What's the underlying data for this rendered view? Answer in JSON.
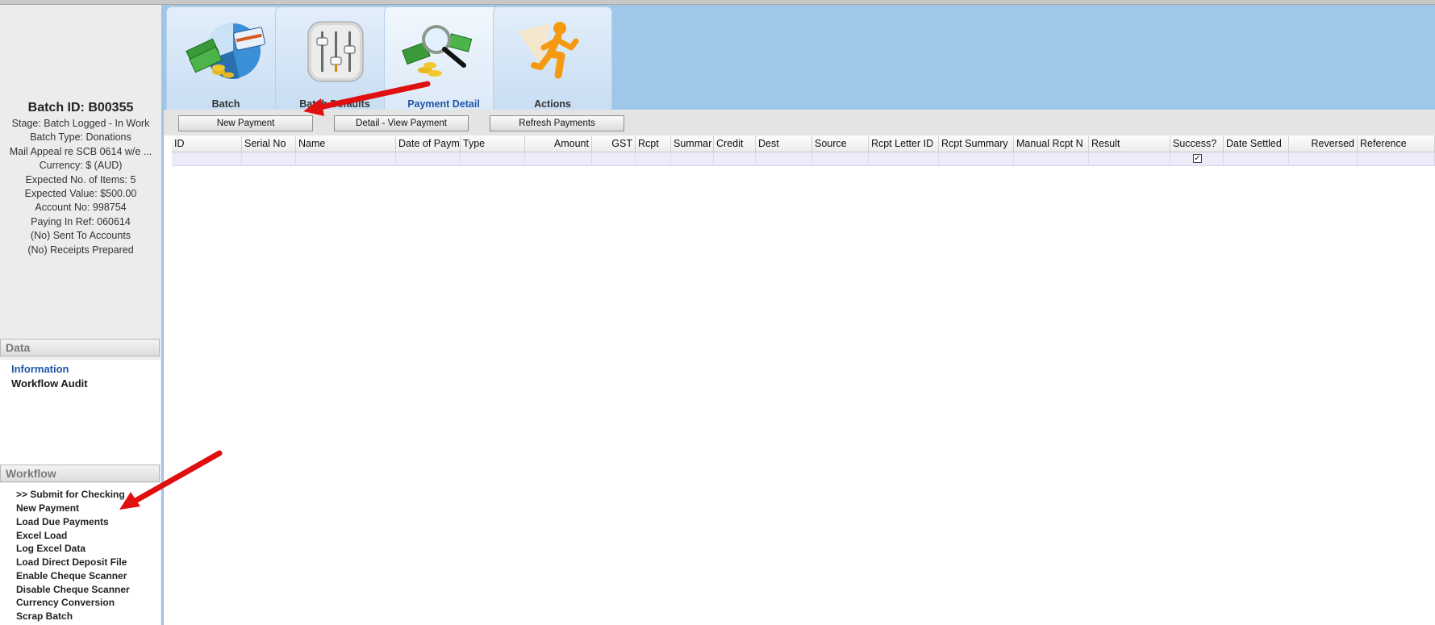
{
  "left_panel": {
    "batch_id": "Batch ID: B00355",
    "info_lines": [
      "Stage: Batch Logged - In Work",
      "Batch Type: Donations",
      "Mail Appeal re SCB 0614 w/e ...",
      "Currency: $ (AUD)",
      "Expected No. of Items: 5",
      "Expected Value: $500.00",
      "Account No: 998754",
      "Paying In Ref: 060614",
      "(No) Sent To Accounts",
      "(No) Receipts Prepared"
    ],
    "data_section": {
      "title": "Data",
      "links": [
        "Information",
        "Workflow Audit"
      ]
    },
    "workflow_section": {
      "title": "Workflow",
      "items": [
        ">> Submit for Checking",
        "New Payment",
        "Load Due Payments",
        "Excel Load",
        "Log Excel Data",
        "Load Direct Deposit File",
        "Enable Cheque Scanner",
        "Disable Cheque Scanner",
        "Currency Conversion",
        "Scrap Batch"
      ]
    }
  },
  "tabs": [
    {
      "label": "Batch",
      "icon": "pie-chart-money-icon"
    },
    {
      "label": "Batch Defaults",
      "icon": "sliders-icon"
    },
    {
      "label": "Payment Detail",
      "icon": "magnifier-money-icon"
    },
    {
      "label": "Actions",
      "icon": "running-man-icon"
    }
  ],
  "active_tab": "Payment Detail",
  "toolbar": {
    "new_payment": "New Payment",
    "detail_view": "Detail - View Payment",
    "refresh": "Refresh Payments"
  },
  "grid": {
    "columns": [
      "ID",
      "Serial No",
      "Name",
      "Date of Paym",
      "Type",
      "Amount",
      "GST",
      "Rcpt",
      "Summar",
      "Credit",
      "Dest",
      "Source",
      "Rcpt Letter ID",
      "Rcpt Summary",
      "Manual Rcpt N",
      "Result",
      "Success?",
      "Date Settled",
      "Reversed",
      "Reference"
    ],
    "rows": [
      {
        "success_checked": true
      }
    ]
  },
  "colors": {
    "accent_blue": "#9ec7ea",
    "active_tab_text": "#1f56a6",
    "annotation_arrow": "#e01010"
  }
}
